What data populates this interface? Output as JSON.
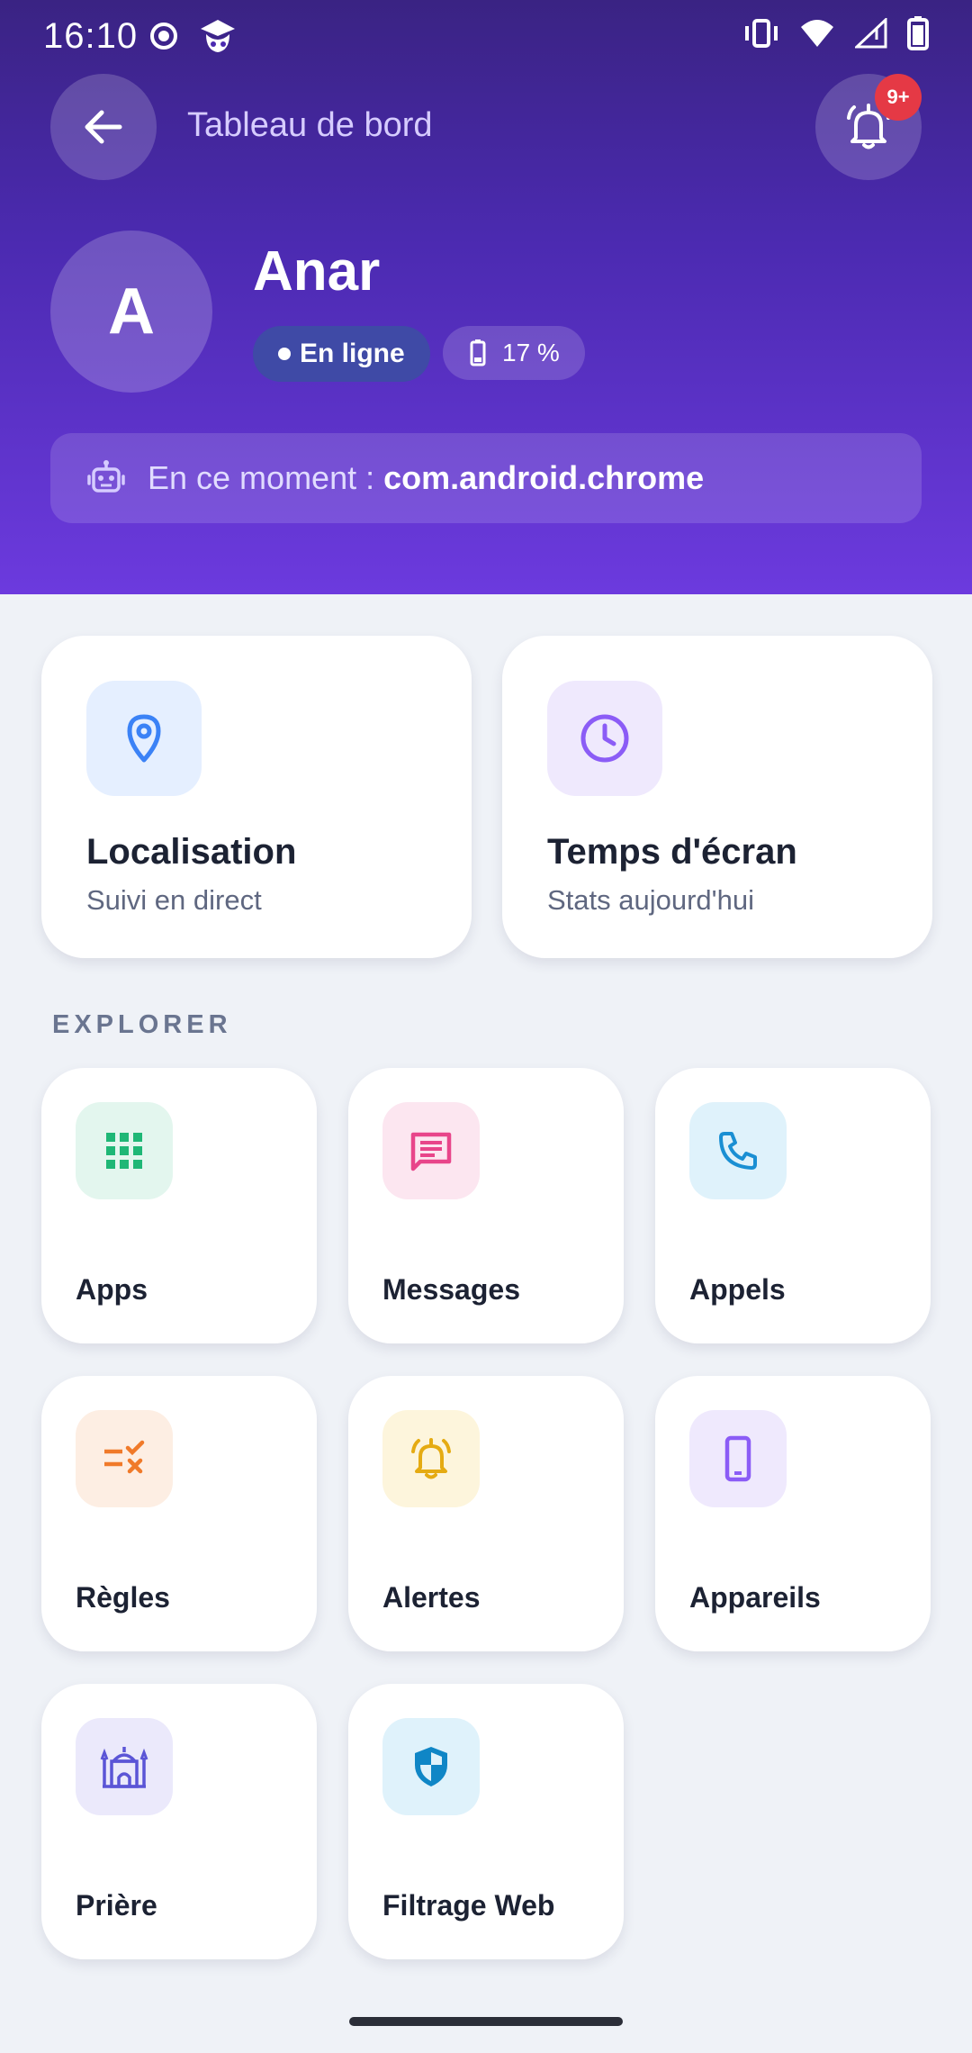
{
  "status_bar": {
    "time": "16:10",
    "icons": [
      "record-icon",
      "app-mascot-icon",
      "vibrate-icon",
      "wifi-icon",
      "signal-icon",
      "battery-icon"
    ]
  },
  "header": {
    "title": "Tableau de bord",
    "notification_badge": "9+"
  },
  "profile": {
    "initial": "A",
    "name": "Anar",
    "status_label": "En ligne",
    "battery_label": "17 %",
    "current_prefix": "En ce moment :",
    "current_app": "com.android.chrome"
  },
  "main_cards": [
    {
      "title": "Localisation",
      "subtitle": "Suivi en direct",
      "icon": "location-pin-icon",
      "icon_color": "#3b82f6",
      "icon_bg": "#e5efff"
    },
    {
      "title": "Temps d'écran",
      "subtitle": "Stats aujourd'hui",
      "icon": "clock-icon",
      "icon_color": "#8b5cf6",
      "icon_bg": "#efe9fd"
    }
  ],
  "section_label": "EXPLORER",
  "explorer": [
    {
      "label": "Apps",
      "icon": "grid-icon",
      "icon_color": "#1fb776",
      "icon_bg": "#e3f6ee"
    },
    {
      "label": "Messages",
      "icon": "message-icon",
      "icon_color": "#e8458a",
      "icon_bg": "#fce6f0"
    },
    {
      "label": "Appels",
      "icon": "phone-icon",
      "icon_color": "#1a8fd3",
      "icon_bg": "#dff2fb"
    },
    {
      "label": "Règles",
      "icon": "rules-icon",
      "icon_color": "#f07a2a",
      "icon_bg": "#fdeee3"
    },
    {
      "label": "Alertes",
      "icon": "alarm-bell-icon",
      "icon_color": "#e5ab12",
      "icon_bg": "#fdf5dc"
    },
    {
      "label": "Appareils",
      "icon": "smartphone-icon",
      "icon_color": "#8b5cf6",
      "icon_bg": "#efe9fd"
    },
    {
      "label": "Prière",
      "icon": "mosque-icon",
      "icon_color": "#5b55d6",
      "icon_bg": "#ebe9fb"
    },
    {
      "label": "Filtrage Web",
      "icon": "shield-icon",
      "icon_color": "#0f86c6",
      "icon_bg": "#dff2fb"
    }
  ]
}
